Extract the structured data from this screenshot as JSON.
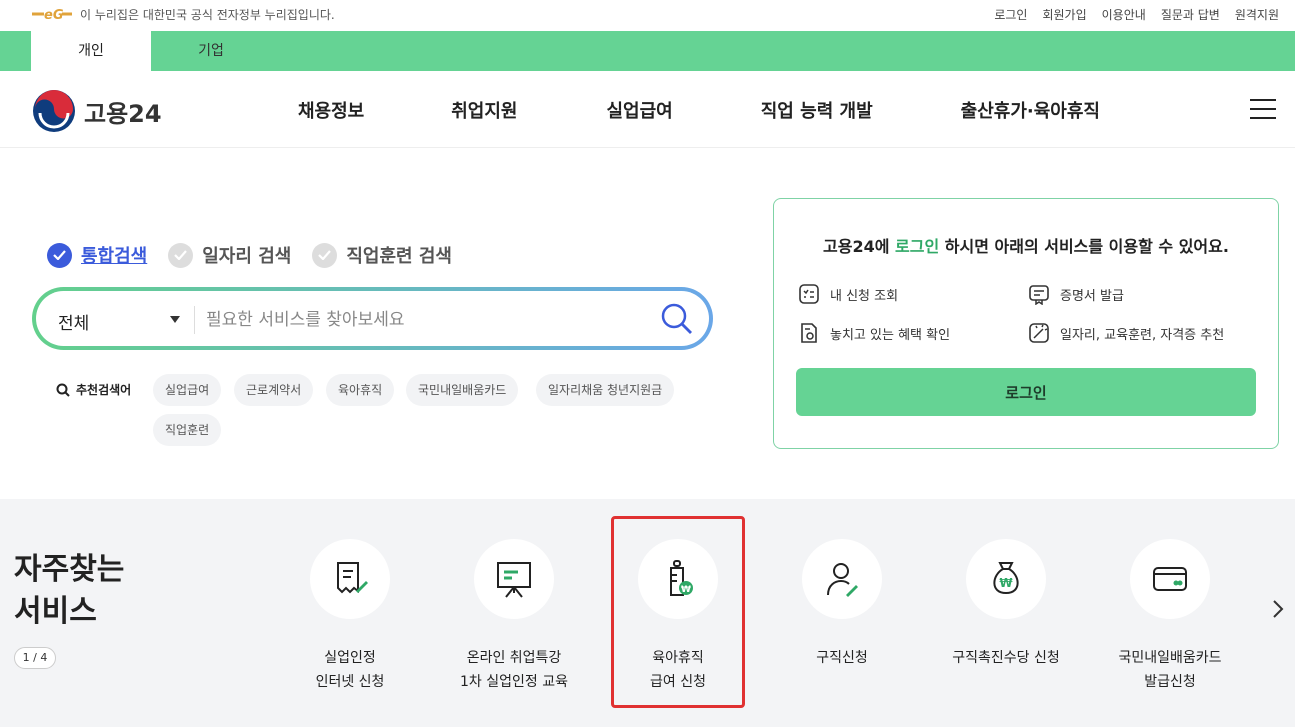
{
  "gov_banner": {
    "text": "이 누리집은 대한민국 공식 전자정부 누리집입니다.",
    "logo_icon": "egov-logo"
  },
  "util_nav": [
    "로그인",
    "회원가입",
    "이용안내",
    "질문과 답변",
    "원격지원"
  ],
  "tabs": [
    {
      "label": "개인",
      "active": true
    },
    {
      "label": "기업",
      "active": false
    }
  ],
  "brand": {
    "name": "고용24",
    "logo_icon": "taegeuk-emblem"
  },
  "gnb": [
    "채용정보",
    "취업지원",
    "실업급여",
    "직업 능력 개발",
    "출산휴가·육아휴직"
  ],
  "search": {
    "types": [
      {
        "label": "통합검색",
        "checked": true
      },
      {
        "label": "일자리 검색",
        "checked": false
      },
      {
        "label": "직업훈련 검색",
        "checked": false
      }
    ],
    "category": "전체",
    "placeholder": "필요한 서비스를 찾아보세요",
    "recommend_label": "추천검색어",
    "chips": [
      "실업급여",
      "근로계약서",
      "육아휴직",
      "국민내일배움카드",
      "일자리채움 청년지원금",
      "직업훈련"
    ]
  },
  "login_box": {
    "title_prefix": "고용24에 ",
    "title_highlight": "로그인",
    "title_suffix": " 하시면 아래의 서비스를 이용할 수 있어요.",
    "services": [
      "내 신청 조회",
      "증명서 발급",
      "놓치고 있는 혜택 확인",
      "일자리, 교육훈련, 자격증 추천"
    ],
    "button": "로그인"
  },
  "frequent": {
    "title_line1": "자주찾는",
    "title_line2": "서비스",
    "pager": "1 / 4",
    "items": [
      {
        "line1": "실업인정",
        "line2": "인터넷 신청",
        "icon": "document-edit-icon"
      },
      {
        "line1": "온라인 취업특강",
        "line2": "1차 실업인정 교육",
        "icon": "presentation-board-icon"
      },
      {
        "line1": "육아휴직",
        "line2": "급여 신청",
        "icon": "baby-bottle-won-icon"
      },
      {
        "line1": "구직신청",
        "line2": "",
        "icon": "person-edit-icon"
      },
      {
        "line1": "구직촉진수당 신청",
        "line2": "",
        "icon": "money-bag-icon"
      },
      {
        "line1": "국민내일배움카드",
        "line2": "발급신청",
        "icon": "card-icon"
      }
    ]
  },
  "colors": {
    "brand_green": "#65d394",
    "highlight_green": "#2fa866",
    "search_blue": "#3b5bdb",
    "annotation_red": "#e03131"
  }
}
